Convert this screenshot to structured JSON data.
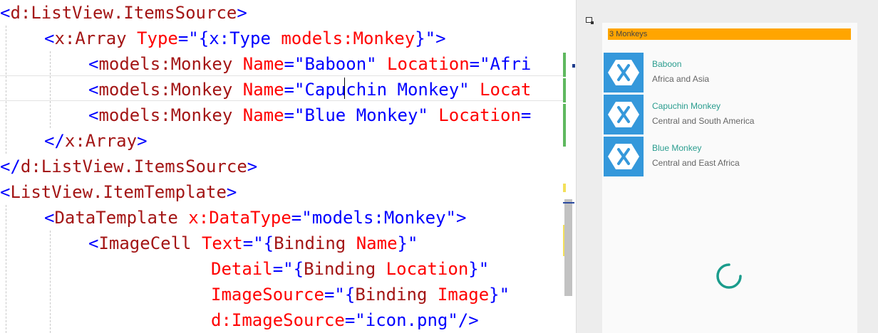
{
  "editor": {
    "lines": [
      [
        {
          "t": "<",
          "c": "br"
        },
        {
          "t": "d:ListView.ItemsSource",
          "c": "el"
        },
        {
          "t": ">",
          "c": "br"
        }
      ],
      [
        {
          "t": "<",
          "c": "br"
        },
        {
          "t": "x:Array",
          "c": "el"
        },
        {
          "t": " Type",
          "c": "at"
        },
        {
          "t": "=\"{x:Type ",
          "c": "va"
        },
        {
          "t": "models:Monkey",
          "c": "at"
        },
        {
          "t": "}\">",
          "c": "va"
        }
      ],
      [
        {
          "t": "<",
          "c": "br"
        },
        {
          "t": "models:Monkey",
          "c": "el"
        },
        {
          "t": " Name",
          "c": "at"
        },
        {
          "t": "=\"Baboon\"",
          "c": "va"
        },
        {
          "t": " Location",
          "c": "at"
        },
        {
          "t": "=\"Afri",
          "c": "va"
        }
      ],
      [
        {
          "t": "<",
          "c": "br"
        },
        {
          "t": "models:Monkey",
          "c": "el"
        },
        {
          "t": " Name",
          "c": "at"
        },
        {
          "t": "=\"Capuchin Monkey\"",
          "c": "va"
        },
        {
          "t": " Locat",
          "c": "at"
        }
      ],
      [
        {
          "t": "<",
          "c": "br"
        },
        {
          "t": "models:Monkey",
          "c": "el"
        },
        {
          "t": " Name",
          "c": "at"
        },
        {
          "t": "=\"Blue Monkey\"",
          "c": "va"
        },
        {
          "t": " Location",
          "c": "at"
        },
        {
          "t": "=",
          "c": "va"
        }
      ],
      [
        {
          "t": "</",
          "c": "br"
        },
        {
          "t": "x:Array",
          "c": "el"
        },
        {
          "t": ">",
          "c": "br"
        }
      ],
      [
        {
          "t": "</",
          "c": "br"
        },
        {
          "t": "d:ListView.ItemsSource",
          "c": "el"
        },
        {
          "t": ">",
          "c": "br"
        }
      ],
      [
        {
          "t": "<",
          "c": "br"
        },
        {
          "t": "ListView.ItemTemplate",
          "c": "el"
        },
        {
          "t": ">",
          "c": "br"
        }
      ],
      [
        {
          "t": "<",
          "c": "br"
        },
        {
          "t": "DataTemplate",
          "c": "el"
        },
        {
          "t": " x:DataType",
          "c": "at"
        },
        {
          "t": "=\"models:Monkey\">",
          "c": "va"
        }
      ],
      [
        {
          "t": "<",
          "c": "br"
        },
        {
          "t": "ImageCell",
          "c": "el"
        },
        {
          "t": " Text",
          "c": "at"
        },
        {
          "t": "=\"{",
          "c": "va"
        },
        {
          "t": "Binding",
          "c": "el"
        },
        {
          "t": " Name",
          "c": "at"
        },
        {
          "t": "}\"",
          "c": "va"
        }
      ],
      [
        {
          "t": "Detail",
          "c": "at"
        },
        {
          "t": "=\"{",
          "c": "va"
        },
        {
          "t": "Binding",
          "c": "el"
        },
        {
          "t": " Location",
          "c": "at"
        },
        {
          "t": "}\"",
          "c": "va"
        }
      ],
      [
        {
          "t": "ImageSource",
          "c": "at"
        },
        {
          "t": "=\"{",
          "c": "va"
        },
        {
          "t": "Binding",
          "c": "el"
        },
        {
          "t": " Image",
          "c": "at"
        },
        {
          "t": "}\"",
          "c": "va"
        }
      ],
      [
        {
          "t": "d:ImageSource",
          "c": "at"
        },
        {
          "t": "=\"icon.png\"/>",
          "c": "va"
        }
      ]
    ]
  },
  "preview": {
    "header": "3 Monkeys",
    "items": [
      {
        "name": "Baboon",
        "location": "Africa and Asia"
      },
      {
        "name": "Capuchin Monkey",
        "location": "Central and South America"
      },
      {
        "name": "Blue Monkey",
        "location": "Central and East Africa"
      }
    ]
  },
  "colors": {
    "element": "#a31515",
    "attribute": "#ff0000",
    "value": "#0000ff",
    "header_bar": "#ffa500",
    "cell_image": "#3498db",
    "cell_text": "#2a9d8f",
    "spinner": "#1a9c8c"
  },
  "icons": {
    "cell_image": "xamarin-icon",
    "loading": "loading-spinner-icon",
    "tool": "element-picker-icon"
  }
}
